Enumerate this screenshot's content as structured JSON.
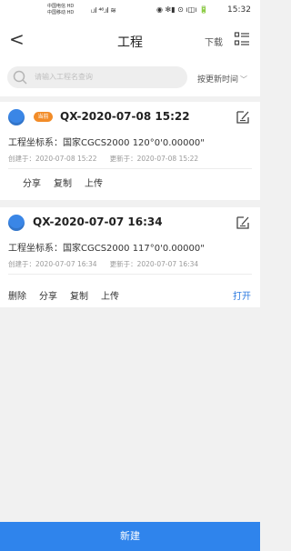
{
  "status_bar": {
    "carrier_top": "中国电信 HD",
    "carrier_bottom": "中国移动 HD",
    "signals": "ₗ.ıl ⁴⁶.ıl ≋",
    "right_icons": "◉ ✻▮ ⊙ ı◫ı 🔋",
    "time": "15:32"
  },
  "nav": {
    "back": "<",
    "title": "工程",
    "download": "下载"
  },
  "search": {
    "placeholder": "请输入工程名查询",
    "sort_label": "按更新时间",
    "sort_chevron": "﹀"
  },
  "projects": [
    {
      "badge": "当前",
      "title": "QX-2020-07-08 15:22",
      "coord": "工程坐标系：国家CGCS2000 120°0'0.00000\"",
      "created": "创建于：2020-07-08 15:22",
      "updated": "更新于：2020-07-08 15:22",
      "actions": [
        "分享",
        "复制",
        "上传"
      ]
    },
    {
      "title": "QX-2020-07-07 16:34",
      "coord": "工程坐标系：国家CGCS2000 117°0'0.00000\"",
      "created": "创建于：2020-07-07 16:34",
      "updated": "更新于：2020-07-07 16:34",
      "actions": [
        "删除",
        "分享",
        "复制",
        "上传"
      ],
      "open": "打开"
    }
  ],
  "footer": {
    "new_button": "新建"
  },
  "colors": {
    "accent": "#2f84ec",
    "badge": "#f28c28",
    "project_icon": "#3a86e6"
  }
}
